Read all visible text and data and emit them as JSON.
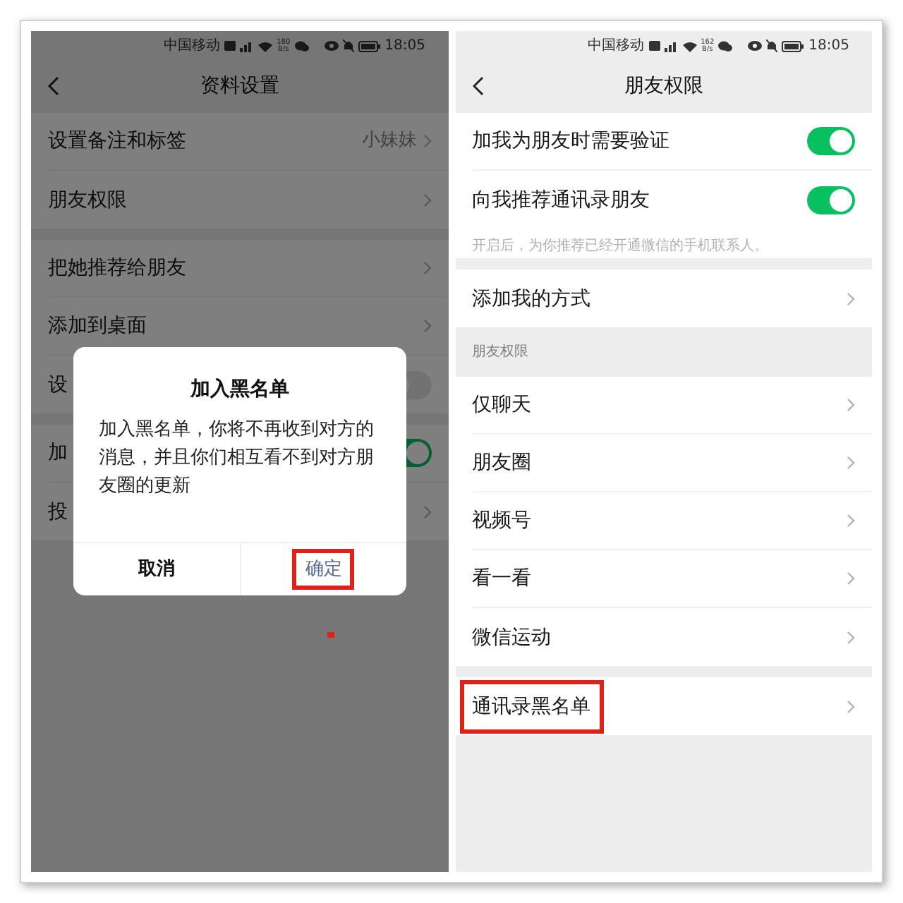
{
  "screens": [
    {
      "status_bar": {
        "carrier": "中国移动",
        "speed": "180",
        "speed_unit": "B/s",
        "time": "18:05"
      },
      "header": {
        "title": "资料设置"
      },
      "groups": [
        [
          {
            "kind": "link",
            "label": "设置备注和标签",
            "value": "小妹妹",
            "highlighted": false
          },
          {
            "kind": "link",
            "label": "朋友权限",
            "highlighted": false
          }
        ],
        [
          {
            "kind": "link",
            "label": "把她推荐给朋友",
            "highlighted": false
          },
          {
            "kind": "link",
            "label": "添加到桌面",
            "highlighted": false
          },
          {
            "kind": "toggle",
            "label": "设",
            "on": false,
            "highlighted": false
          }
        ],
        [
          {
            "kind": "toggle",
            "label": "加",
            "on": true,
            "highlighted": false
          },
          {
            "kind": "link",
            "label": "投",
            "highlighted": false
          }
        ]
      ],
      "dialog": {
        "title": "加入黑名单",
        "message": "加入黑名单，你将不再收到对方的消息，并且你们相互看不到对方朋友圈的更新",
        "buttons": [
          {
            "label": "取消",
            "primary": false,
            "highlighted": false
          },
          {
            "label": "确定",
            "primary": true,
            "highlighted": true
          }
        ]
      }
    },
    {
      "status_bar": {
        "carrier": "中国移动",
        "speed": "162",
        "speed_unit": "B/s",
        "time": "18:05"
      },
      "header": {
        "title": "朋友权限"
      },
      "groups": [
        [
          {
            "kind": "toggle",
            "label": "加我为朋友时需要验证",
            "on": true,
            "highlighted": false
          },
          {
            "kind": "toggle",
            "label": "向我推荐通讯录朋友",
            "on": true,
            "note": "开启后，为你推荐已经开通微信的手机联系人。",
            "highlighted": false
          }
        ],
        [
          {
            "kind": "link",
            "label": "添加我的方式",
            "highlighted": false
          }
        ],
        {
          "section": "朋友权限",
          "rows": [
            {
              "kind": "link",
              "label": "仅聊天",
              "highlighted": false
            },
            {
              "kind": "link",
              "label": "朋友圈",
              "highlighted": false
            },
            {
              "kind": "link",
              "label": "视频号",
              "highlighted": false
            },
            {
              "kind": "link",
              "label": "看一看",
              "highlighted": false
            },
            {
              "kind": "link",
              "label": "微信运动",
              "highlighted": false
            }
          ]
        },
        [
          {
            "kind": "link",
            "label": "通讯录黑名单",
            "highlighted": true
          }
        ]
      ]
    }
  ]
}
